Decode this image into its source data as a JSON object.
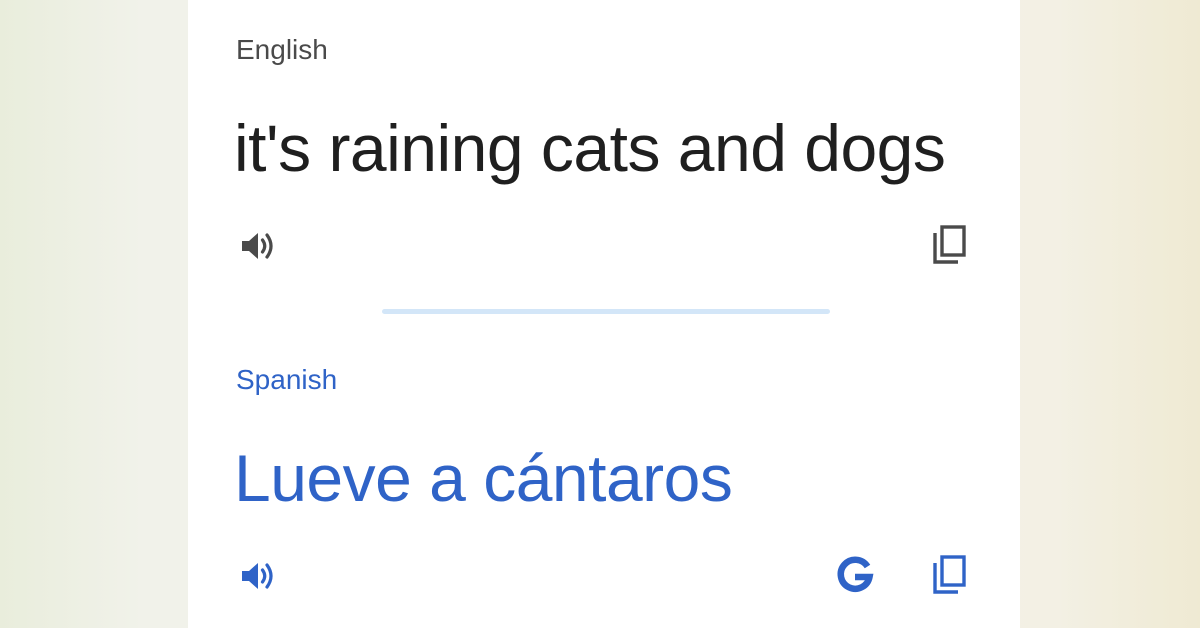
{
  "source": {
    "language": "English",
    "text": "it's raining cats and dogs",
    "speak_icon": "speaker-icon",
    "copy_icon": "copy-icon"
  },
  "target": {
    "language": "Spanish",
    "text": "Lueve a cántaros",
    "speak_icon": "speaker-icon",
    "google_icon": "google-g-icon",
    "copy_icon": "copy-icon"
  },
  "colors": {
    "source_text": "#1f1f1f",
    "source_label": "#4a4a4a",
    "accent_blue": "#2f63c7",
    "icon_gray": "#4a4a4a",
    "divider": "#d3e6f8",
    "card": "#ffffff"
  }
}
